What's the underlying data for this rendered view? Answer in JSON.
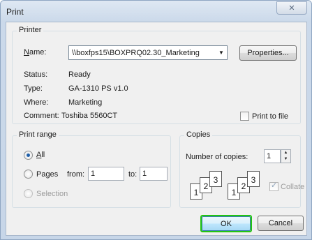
{
  "window": {
    "title": "Print",
    "close_glyph": "✕"
  },
  "printer": {
    "group_label": "Printer",
    "name_label": "Name:",
    "name_value": "\\\\boxfps15\\BOXPRQ02.30_Marketing",
    "properties_button": "Properties...",
    "status_label": "Status:",
    "status_value": "Ready",
    "type_label": "Type:",
    "type_value": "GA-1310 PS v1.0",
    "where_label": "Where:",
    "where_value": "Marketing",
    "comment_label": "Comment:",
    "comment_value": "Toshiba 5560CT",
    "print_to_file_label": "Print to file"
  },
  "print_range": {
    "group_label": "Print range",
    "all_label": "All",
    "pages_label": "Pages",
    "from_label": "from:",
    "from_value": "1",
    "to_label": "to:",
    "to_value": "1",
    "selection_label": "Selection"
  },
  "copies": {
    "group_label": "Copies",
    "number_label": "Number of copies:",
    "number_value": "1",
    "collate_label": "Collate",
    "page_digits": [
      "1",
      "2",
      "3"
    ]
  },
  "footer": {
    "ok_button": "OK",
    "cancel_button": "Cancel"
  },
  "colors": {
    "focus_ring": "#22c511",
    "accent": "#1f5fa9"
  }
}
